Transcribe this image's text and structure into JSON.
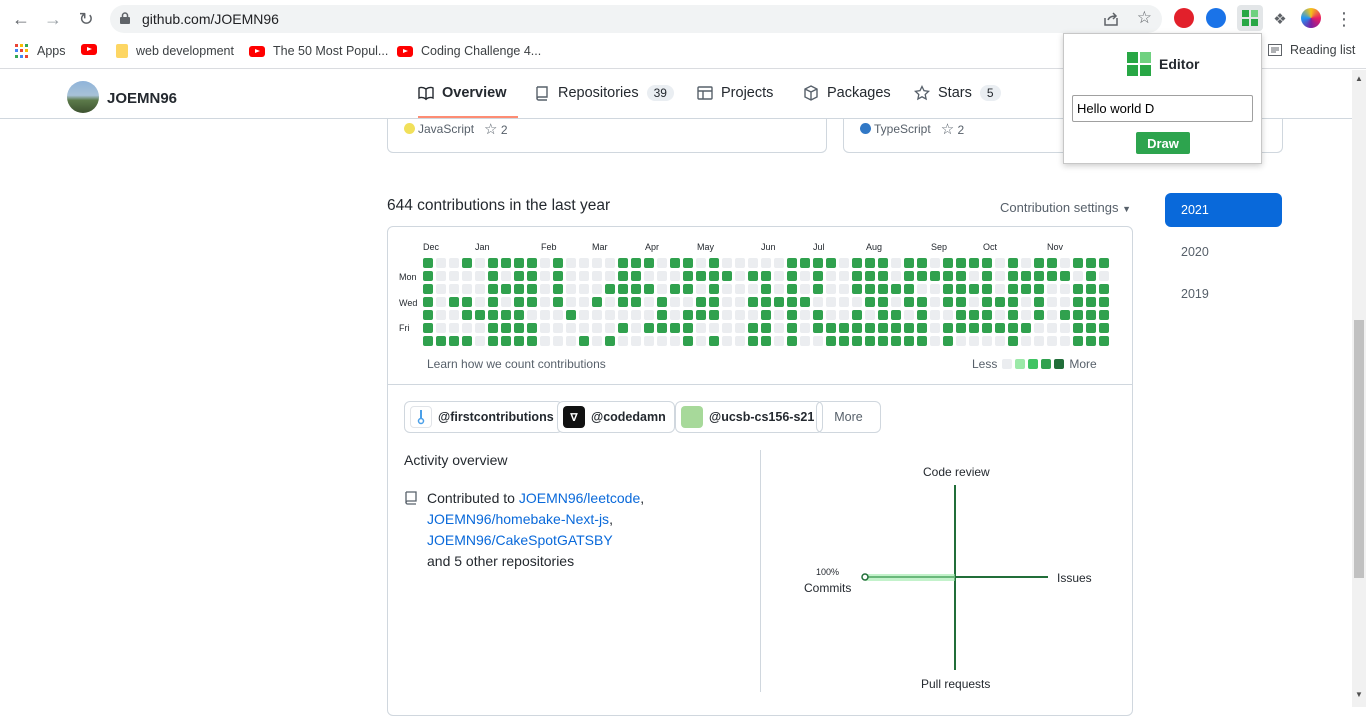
{
  "browser": {
    "url": "github.com/JOEMN96",
    "bookmarks": [
      {
        "label": "Apps"
      },
      {
        "label": ""
      },
      {
        "label": "web development"
      },
      {
        "label": "The 50 Most Popul..."
      },
      {
        "label": "Coding Challenge 4..."
      }
    ],
    "reading_list": "Reading list"
  },
  "profile": {
    "username": "JOEMN96"
  },
  "tabs": [
    {
      "label": "Overview",
      "count": ""
    },
    {
      "label": "Repositories",
      "count": "39"
    },
    {
      "label": "Projects",
      "count": ""
    },
    {
      "label": "Packages",
      "count": ""
    },
    {
      "label": "Stars",
      "count": "5"
    }
  ],
  "pinned": [
    {
      "language": "JavaScript",
      "lang_color": "#f1e05a",
      "stars": "2"
    },
    {
      "language": "TypeScript",
      "lang_color": "#3178c6",
      "stars": "2"
    }
  ],
  "contributions": {
    "title": "644 contributions in the last year",
    "settings_label": "Contribution settings",
    "months": [
      "Dec",
      "Jan",
      "Feb",
      "Mar",
      "Apr",
      "May",
      "Jun",
      "Jul",
      "Aug",
      "Sep",
      "Oct",
      "Nov"
    ],
    "days": [
      "Mon",
      "Wed",
      "Fri"
    ],
    "learn_label": "Learn how we count contributions",
    "legend_less": "Less",
    "legend_more": "More",
    "colors": {
      "empty": "#ebedf0",
      "l1": "#9be9a8",
      "l2": "#40c463",
      "l3": "#30a14e",
      "l4": "#216e39"
    }
  },
  "orgs": [
    {
      "label": "@firstcontributions"
    },
    {
      "label": "@codedamn"
    },
    {
      "label": "@ucsb-cs156-s21"
    }
  ],
  "more_label": "More",
  "activity": {
    "title": "Activity overview",
    "contributed_to": "Contributed to",
    "repo1": "JOEMN96/leetcode",
    "repo2": "JOEMN96/homebake-Next-js",
    "repo3": "JOEMN96/CakeSpotGATSBY",
    "others": "and 5 other repositories",
    "axis": {
      "code_review": "Code review",
      "issues": "Issues",
      "pull_requests": "Pull requests",
      "commits": "Commits",
      "commits_pct": "100%"
    }
  },
  "years": [
    "2021",
    "2020",
    "2019"
  ],
  "popup": {
    "title": "Editor",
    "input_value": "Hello world D",
    "button": "Draw"
  }
}
